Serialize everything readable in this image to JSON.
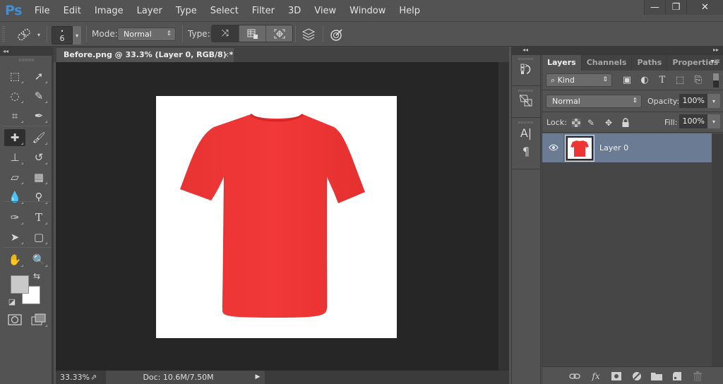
{
  "app": {
    "logo": "Ps",
    "menu": [
      "File",
      "Edit",
      "Image",
      "Layer",
      "Type",
      "Select",
      "Filter",
      "3D",
      "View",
      "Window",
      "Help"
    ],
    "window_controls": {
      "minimize": "—",
      "restore": "❐",
      "close": "✕"
    }
  },
  "options_bar": {
    "tool_icon": "spot-healing-brush-icon",
    "brush_size": "6",
    "brush_dot": "•",
    "mode_label": "Mode:",
    "mode_value": "Normal",
    "type_label": "Type:",
    "type_options": [
      "Proximity Match",
      "Create Texture",
      "Content-Aware"
    ],
    "type_selected": "Proximity Match",
    "sample_all_layers_icon": "sample-all-layers-icon",
    "pressure_icon": "pressure-icon"
  },
  "tools": {
    "collapse": "◂◂",
    "items": [
      {
        "name": "rectangular-marquee",
        "glyph": "⬚"
      },
      {
        "name": "move",
        "glyph": "➚"
      },
      {
        "name": "lasso",
        "glyph": "◌"
      },
      {
        "name": "quick-selection",
        "glyph": "✎"
      },
      {
        "name": "crop",
        "glyph": "⌗"
      },
      {
        "name": "eyedropper",
        "glyph": "✒"
      },
      {
        "name": "spot-healing-brush",
        "glyph": "✚",
        "active": true
      },
      {
        "name": "brush",
        "glyph": "🖌"
      },
      {
        "name": "clone-stamp",
        "glyph": "⊥"
      },
      {
        "name": "history-brush",
        "glyph": "↺"
      },
      {
        "name": "eraser",
        "glyph": "▱"
      },
      {
        "name": "gradient",
        "glyph": "▦"
      },
      {
        "name": "blur",
        "glyph": "💧"
      },
      {
        "name": "dodge",
        "glyph": "⚲"
      },
      {
        "name": "pen",
        "glyph": "✑"
      },
      {
        "name": "type",
        "glyph": "T"
      },
      {
        "name": "path-selection",
        "glyph": "➤"
      },
      {
        "name": "rectangle-shape",
        "glyph": "▢"
      },
      {
        "name": "hand",
        "glyph": "✋"
      },
      {
        "name": "zoom",
        "glyph": "🔍"
      }
    ],
    "foreground_color": "#c9c9c9",
    "background_color": "#ffffff",
    "swap_glyph": "⇆",
    "default_colors_glyph": "◪",
    "quick_mask_glyph": "◙",
    "screen_mode_glyph": "❐"
  },
  "document": {
    "tab_title": "Before.png @ 33.3% (Layer 0, RGB/8) *",
    "tab_close": "×",
    "shirt_color": "#ee3535",
    "canvas_bg": "#ffffff"
  },
  "status_bar": {
    "zoom": "33.33%",
    "doc_info": "Doc: 10.6M/7.50M",
    "share_glyph": "⇗",
    "play_glyph": "▶"
  },
  "mini_dock": {
    "collapse": "◂◂",
    "expand": "▸▸",
    "groups": [
      {
        "icons": [
          {
            "name": "history-icon",
            "glyph": "⟲"
          }
        ]
      },
      {
        "icons": [
          {
            "name": "properties-icon",
            "glyph": "⧉"
          }
        ]
      },
      {
        "icons": [
          {
            "name": "character-icon",
            "glyph": "A|"
          },
          {
            "name": "paragraph-icon",
            "glyph": "¶"
          }
        ]
      }
    ]
  },
  "layers_panel": {
    "tabs": [
      "Layers",
      "Channels",
      "Paths",
      "Properties"
    ],
    "active_tab": "Layers",
    "menu_glyph": "▾≡",
    "filter_kind": "Kind",
    "search_glyph": "⌕",
    "filter_icons": [
      {
        "name": "pixel-filter-icon",
        "glyph": "▣"
      },
      {
        "name": "adjustment-filter-icon",
        "glyph": "◐"
      },
      {
        "name": "type-filter-icon",
        "glyph": "T"
      },
      {
        "name": "shape-filter-icon",
        "glyph": "⬚"
      },
      {
        "name": "smart-object-filter-icon",
        "glyph": "⎘"
      }
    ],
    "blend_mode": "Normal",
    "opacity_label": "Opacity:",
    "opacity_value": "100%",
    "lock_label": "Lock:",
    "lock_icons": [
      {
        "name": "lock-transparent-icon",
        "glyph": "▩"
      },
      {
        "name": "lock-image-icon",
        "glyph": "✎"
      },
      {
        "name": "lock-position-icon",
        "glyph": "✥"
      },
      {
        "name": "lock-all-icon",
        "glyph": "🔒"
      }
    ],
    "fill_label": "Fill:",
    "fill_value": "100%",
    "layers": [
      {
        "name": "Layer 0",
        "visible": true,
        "selected": true,
        "eye_glyph": "👁"
      }
    ],
    "footer_icons": [
      {
        "name": "link-layers-icon",
        "glyph": "⊖"
      },
      {
        "name": "layer-style-icon",
        "glyph": "fx"
      },
      {
        "name": "layer-mask-icon",
        "glyph": "◘"
      },
      {
        "name": "adjustment-layer-icon",
        "glyph": "◑"
      },
      {
        "name": "new-group-icon",
        "glyph": "▬"
      },
      {
        "name": "new-layer-icon",
        "glyph": "◳"
      },
      {
        "name": "delete-layer-icon",
        "glyph": "🗑",
        "disabled": true
      }
    ]
  }
}
